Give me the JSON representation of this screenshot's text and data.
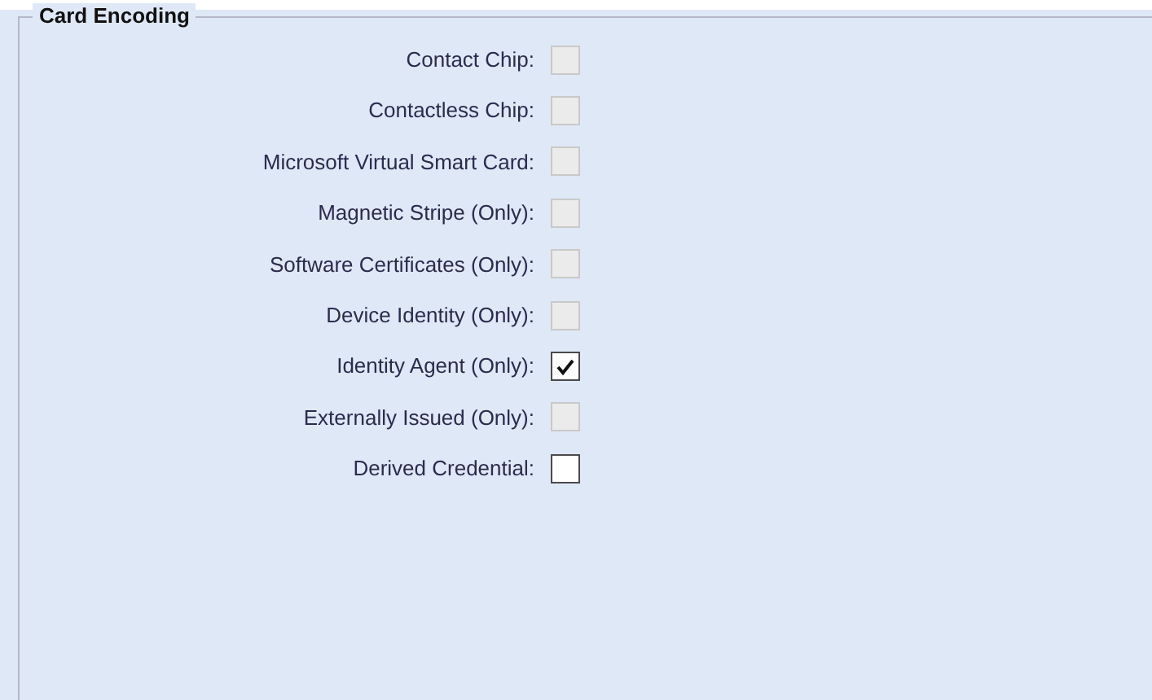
{
  "group": {
    "title": "Card Encoding"
  },
  "options": [
    {
      "label": "Contact Chip:",
      "checked": false,
      "disabled": true
    },
    {
      "label": "Contactless Chip:",
      "checked": false,
      "disabled": true
    },
    {
      "label": "Microsoft Virtual Smart Card:",
      "checked": false,
      "disabled": true
    },
    {
      "label": "Magnetic Stripe (Only):",
      "checked": false,
      "disabled": true
    },
    {
      "label": "Software Certificates (Only):",
      "checked": false,
      "disabled": true
    },
    {
      "label": "Device Identity (Only):",
      "checked": false,
      "disabled": true
    },
    {
      "label": "Identity Agent (Only):",
      "checked": true,
      "disabled": false
    },
    {
      "label": "Externally Issued (Only):",
      "checked": false,
      "disabled": true
    },
    {
      "label": "Derived Credential:",
      "checked": false,
      "disabled": false
    }
  ]
}
